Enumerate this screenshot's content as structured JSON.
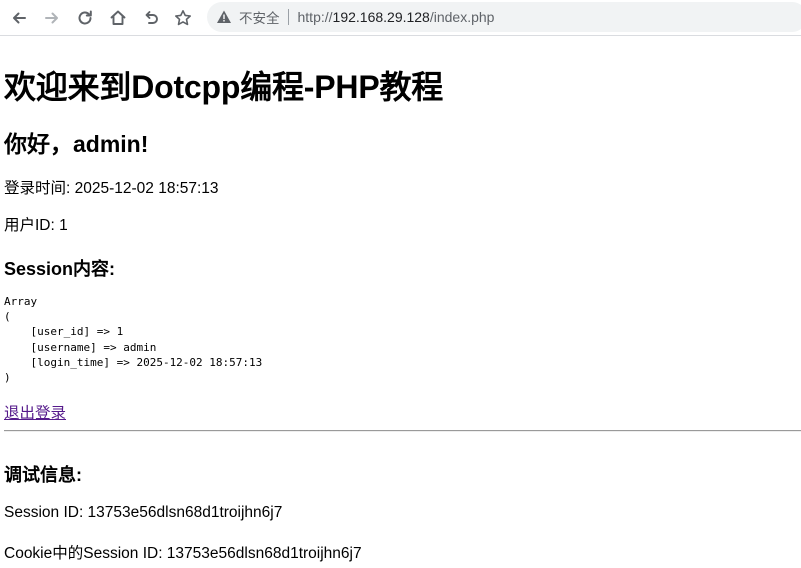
{
  "browser": {
    "security_label": "不安全",
    "url_scheme": "http://",
    "url_host": "192.168.29.128",
    "url_path": "/index.php"
  },
  "page": {
    "title": "欢迎来到Dotcpp编程-PHP教程",
    "greeting": "你好，admin!",
    "login_time": "登录时间: 2025-12-02 18:57:13",
    "user_id": "用户ID: 1",
    "session_heading": "Session内容:",
    "session_dump": "Array\n(\n    [user_id] => 1\n    [username] => admin\n    [login_time] => 2025-12-02 18:57:13\n)",
    "logout_link": "退出登录",
    "debug_heading": "调试信息:",
    "session_id": "Session ID: 13753e56dlsn68d1troijhn6j7",
    "cookie_session_id": "Cookie中的Session ID: 13753e56dlsn68d1troijhn6j7"
  },
  "icons": {
    "back": "back-arrow-icon",
    "forward": "forward-arrow-icon",
    "reload": "reload-icon",
    "home": "home-icon",
    "undo": "undo-icon",
    "bookmark": "star-icon",
    "security": "warning-icon"
  },
  "colors": {
    "visited_link": "#551a8b",
    "omnibox_bg": "#f1f3f4"
  }
}
